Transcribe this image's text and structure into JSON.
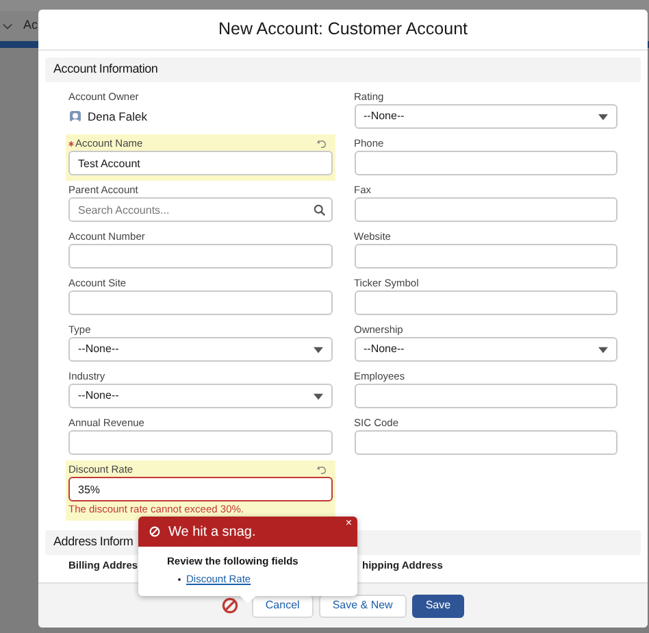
{
  "background": {
    "tab": "Ac"
  },
  "modal": {
    "title": "New Account: Customer Account",
    "sections": [
      {
        "title": "Account Information",
        "rows": [
          {
            "left": {
              "kind": "owner",
              "label": "Account Owner",
              "value": "Dena Falek"
            },
            "right": {
              "kind": "select",
              "label": "Rating",
              "value": "--None--",
              "required": false,
              "edited": false
            }
          },
          {
            "left": {
              "kind": "text",
              "label": "Account Name",
              "value": "Test Account",
              "required": true,
              "edited": true
            },
            "right": {
              "kind": "text",
              "label": "Phone",
              "required": false,
              "edited": false
            }
          },
          {
            "left": {
              "kind": "lookup",
              "label": "Parent Account",
              "placeholder": "Search Accounts...",
              "required": false,
              "edited": false
            },
            "right": {
              "kind": "text",
              "label": "Fax",
              "required": false,
              "edited": false
            }
          },
          {
            "left": {
              "kind": "text",
              "label": "Account Number",
              "required": false,
              "edited": false
            },
            "right": {
              "kind": "text",
              "label": "Website",
              "required": false,
              "edited": false
            }
          },
          {
            "left": {
              "kind": "text",
              "label": "Account Site",
              "required": false,
              "edited": false
            },
            "right": {
              "kind": "text",
              "label": "Ticker Symbol",
              "required": false,
              "edited": false
            }
          },
          {
            "left": {
              "kind": "select",
              "label": "Type",
              "value": "--None--",
              "required": false,
              "edited": false
            },
            "right": {
              "kind": "select",
              "label": "Ownership",
              "value": "--None--",
              "required": false,
              "edited": false
            }
          },
          {
            "left": {
              "kind": "select",
              "label": "Industry",
              "value": "--None--",
              "required": false,
              "edited": false
            },
            "right": {
              "kind": "text",
              "label": "Employees",
              "required": false,
              "edited": false
            }
          },
          {
            "left": {
              "kind": "text",
              "label": "Annual Revenue",
              "required": false,
              "edited": false
            },
            "right": {
              "kind": "text",
              "label": "SIC Code",
              "required": false,
              "edited": false
            }
          },
          {
            "left": {
              "kind": "text",
              "label": "Discount Rate",
              "value": "35%",
              "required": false,
              "edited": true,
              "error": "The discount rate cannot exceed 30%."
            }
          }
        ]
      },
      {
        "title": "Address Inform",
        "rows": [
          {
            "left": {
              "kind": "heading",
              "label": "Billing Addres"
            },
            "right": {
              "kind": "heading",
              "label": "hipping Address"
            }
          }
        ]
      }
    ],
    "popover": {
      "title": "We hit a snag.",
      "close": "×",
      "intro": "Review the following fields",
      "links": [
        "Discount Rate"
      ]
    },
    "footer": {
      "buttons": [
        {
          "label": "Cancel",
          "kind": "neutral"
        },
        {
          "label": "Save & New",
          "kind": "neutral"
        },
        {
          "label": "Save",
          "kind": "brand"
        }
      ]
    }
  }
}
